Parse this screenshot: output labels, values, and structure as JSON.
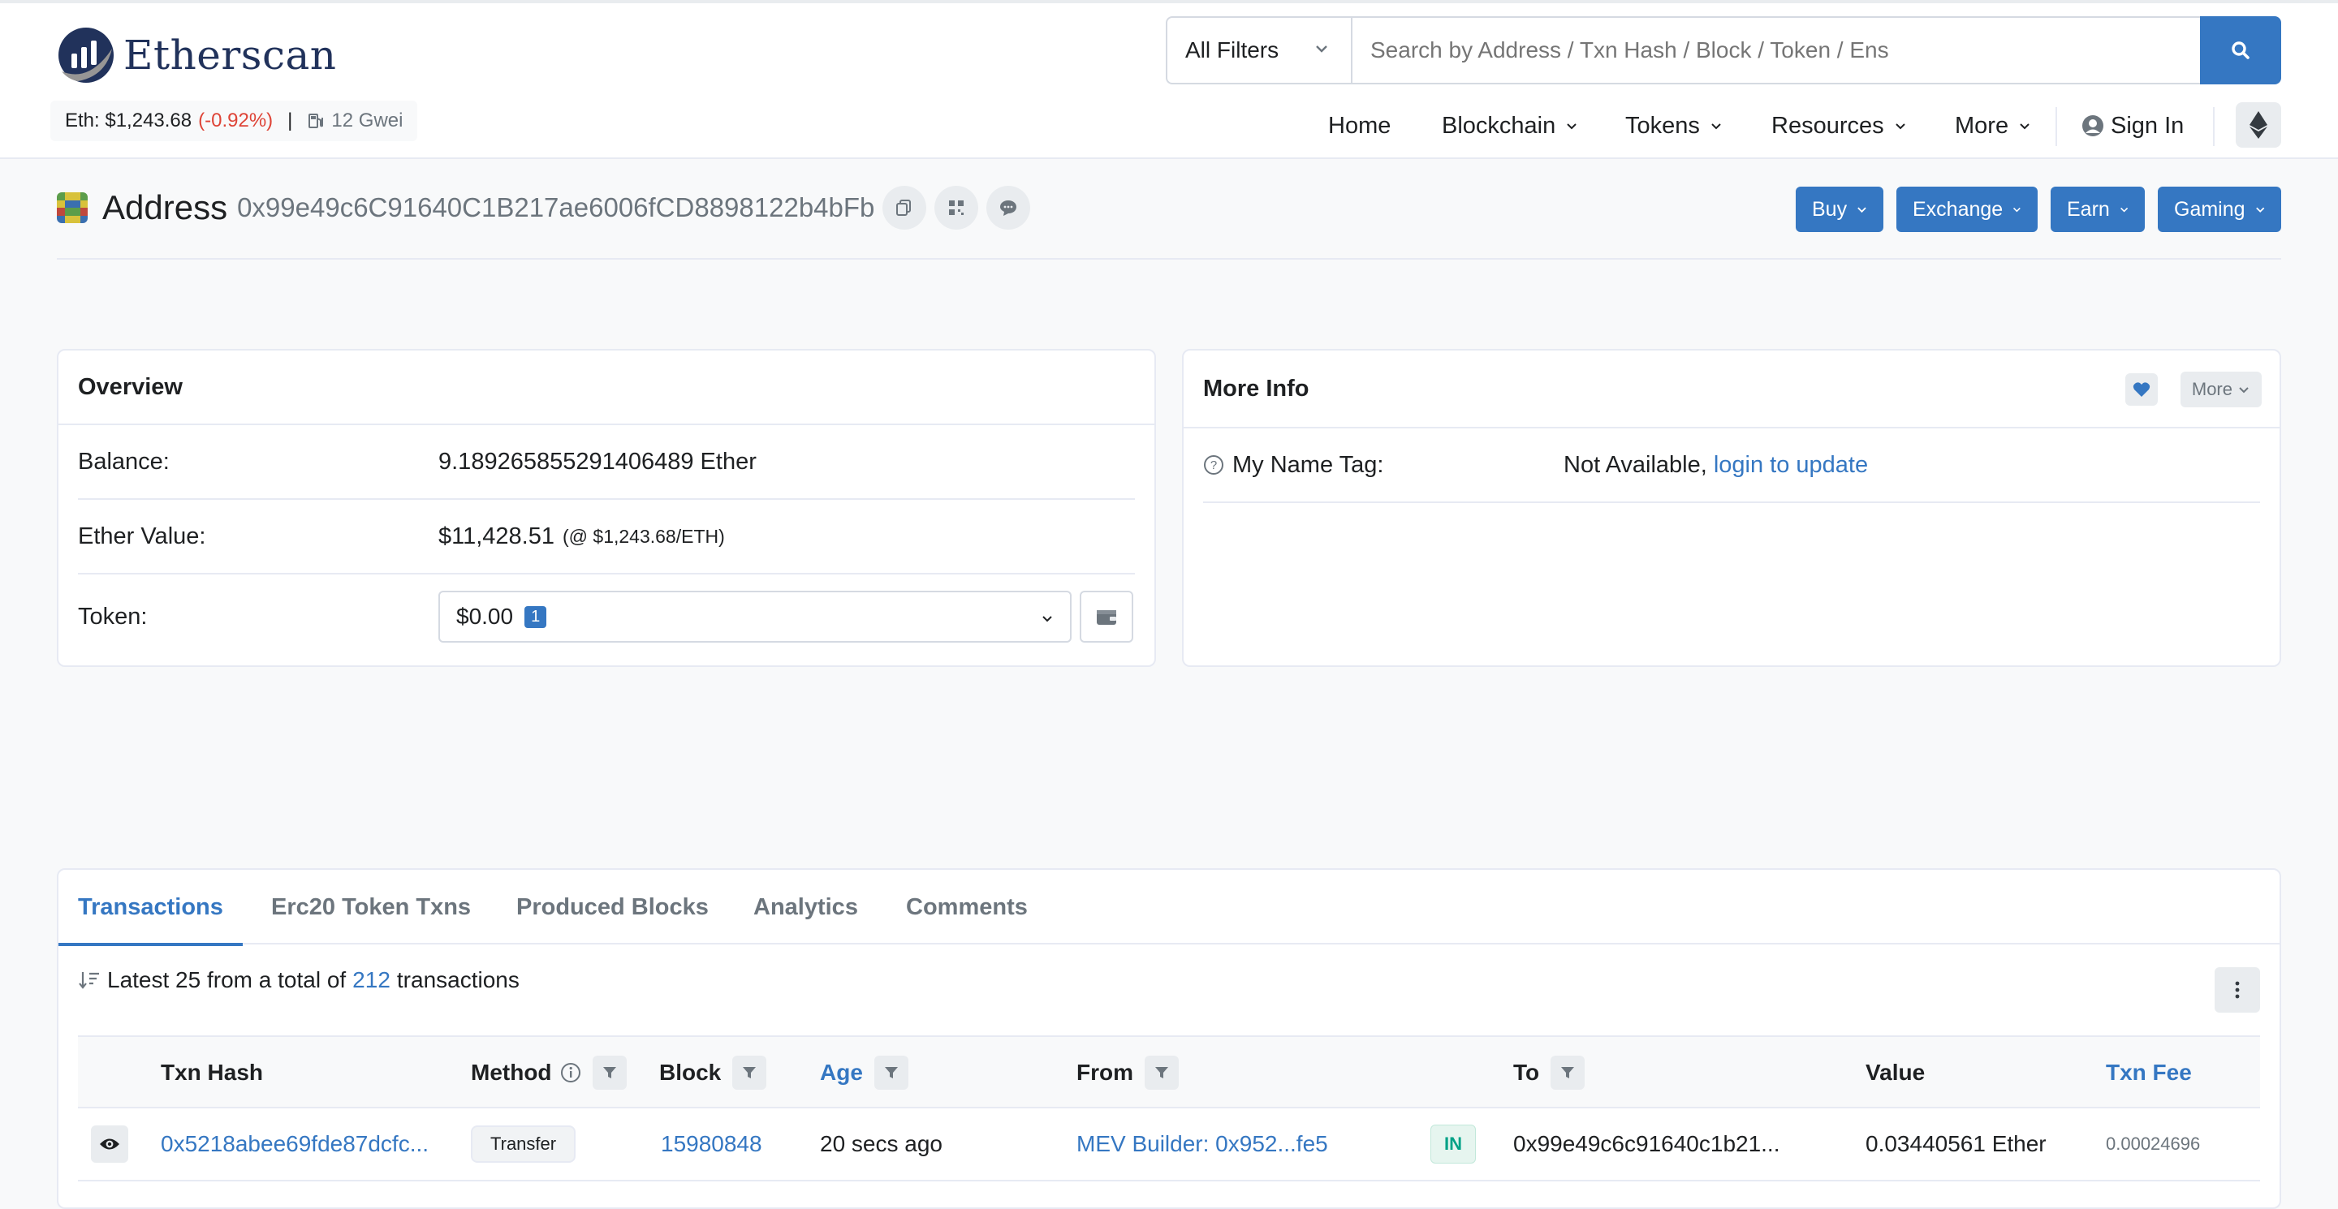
{
  "brand": {
    "name": "Etherscan"
  },
  "eth_price": {
    "label": "Eth: $1,243.68",
    "change": "(-0.92%)",
    "separator": "|",
    "gas": "12 Gwei"
  },
  "search": {
    "filter": "All Filters",
    "placeholder": "Search by Address / Txn Hash / Block / Token / Ens"
  },
  "nav": {
    "home": "Home",
    "blockchain": "Blockchain",
    "tokens": "Tokens",
    "resources": "Resources",
    "more": "More",
    "signin": "Sign In"
  },
  "address": {
    "label": "Address",
    "value": "0x99e49c6C91640C1B217ae6006fCD8898122b4bFb"
  },
  "actions": {
    "buy": "Buy",
    "exchange": "Exchange",
    "earn": "Earn",
    "gaming": "Gaming"
  },
  "overview": {
    "title": "Overview",
    "balance_label": "Balance:",
    "balance_value": "9.189265855291406489 Ether",
    "ether_value_label": "Ether Value:",
    "ether_value": "$11,428.51",
    "ether_rate": "(@ $1,243.68/ETH)",
    "token_label": "Token:",
    "token_value": "$0.00",
    "token_count": "1"
  },
  "more_info": {
    "title": "More Info",
    "more_label": "More",
    "name_tag_label": "My Name Tag:",
    "name_tag_value": "Not Available,",
    "name_tag_link": "login to update"
  },
  "tabs": [
    "Transactions",
    "Erc20 Token Txns",
    "Produced Blocks",
    "Analytics",
    "Comments"
  ],
  "txn_summary": {
    "prefix": "Latest 25 from a total of",
    "count": "212",
    "suffix": "transactions"
  },
  "table": {
    "headers": {
      "hash": "Txn Hash",
      "method": "Method",
      "block": "Block",
      "age": "Age",
      "from": "From",
      "to": "To",
      "value": "Value",
      "fee": "Txn Fee"
    },
    "rows": [
      {
        "hash": "0x5218abee69fde87dcfc...",
        "method": "Transfer",
        "block": "15980848",
        "age": "20 secs ago",
        "from": "MEV Builder: 0x952...fe5",
        "direction": "IN",
        "to": "0x99e49c6c91640c1b21...",
        "value": "0.03440561 Ether",
        "fee": "0.00024696"
      }
    ]
  },
  "colors": {
    "accent": "#3577c2",
    "negative": "#de4437",
    "success": "#00a186"
  }
}
